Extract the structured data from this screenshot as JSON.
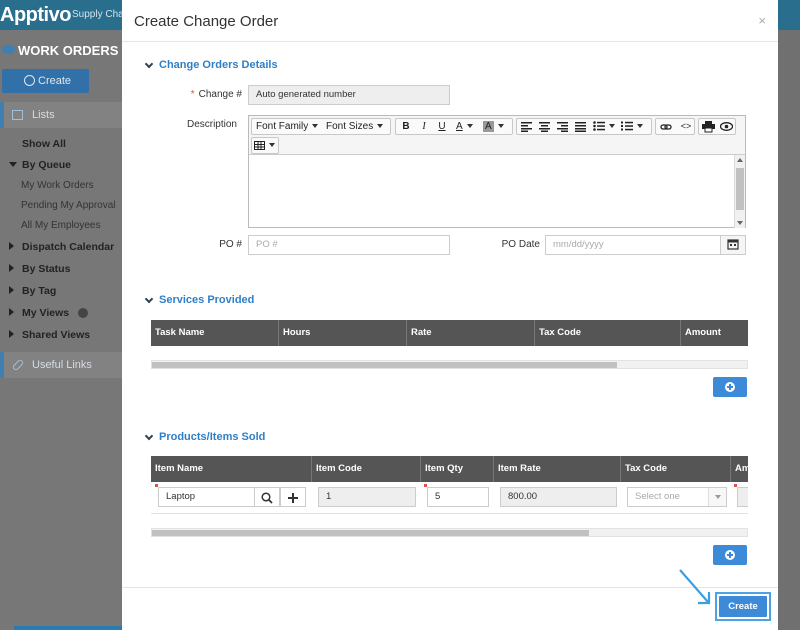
{
  "app": {
    "logo": "Apptivo",
    "top_tab": "Supply Cha",
    "module_title": "WORK ORDERS"
  },
  "sidebar": {
    "create_label": "Create",
    "lists_label": "Lists",
    "items": {
      "show_all": "Show All",
      "by_queue": "By Queue",
      "my_work_orders": "My Work Orders",
      "pending_my_approval": "Pending My Approval",
      "all_my_employees": "All My Employees",
      "dispatch_calendar": "Dispatch Calendar",
      "by_status": "By Status",
      "by_tag": "By Tag",
      "my_views": "My Views",
      "shared_views": "Shared Views"
    },
    "useful_links_label": "Useful Links"
  },
  "modal": {
    "title": "Create Change Order",
    "close_glyph": "×",
    "details": {
      "heading": "Change Orders Details",
      "change_number_label": "Change #",
      "change_number_value": "Auto generated number",
      "description_label": "Description",
      "toolbar": {
        "font_family": "Font Family",
        "font_sizes": "Font Sizes",
        "bold": "B",
        "italic": "I",
        "underline": "U",
        "text_color": "A",
        "bg_color": "A",
        "source": "<>"
      },
      "po_label": "PO #",
      "po_placeholder": "PO #",
      "po_date_label": "PO Date",
      "po_date_placeholder": "mm/dd/yyyy"
    },
    "services": {
      "heading": "Services Provided",
      "columns": [
        "Task Name",
        "Hours",
        "Rate",
        "Tax Code",
        "Amount"
      ]
    },
    "products": {
      "heading": "Products/Items Sold",
      "columns": [
        "Item Name",
        "Item Code",
        "Item Qty",
        "Item Rate",
        "Tax Code",
        "Am"
      ],
      "row": {
        "item_name": "Laptop",
        "item_code": "1",
        "item_qty": "5",
        "item_rate": "800.00",
        "tax_code_placeholder": "Select one"
      }
    },
    "create_button": "Create"
  },
  "colors": {
    "accent": "#3c8ad8",
    "heading_blue": "#2f7fc6",
    "table_header": "#555555",
    "required": "#d9534f"
  }
}
